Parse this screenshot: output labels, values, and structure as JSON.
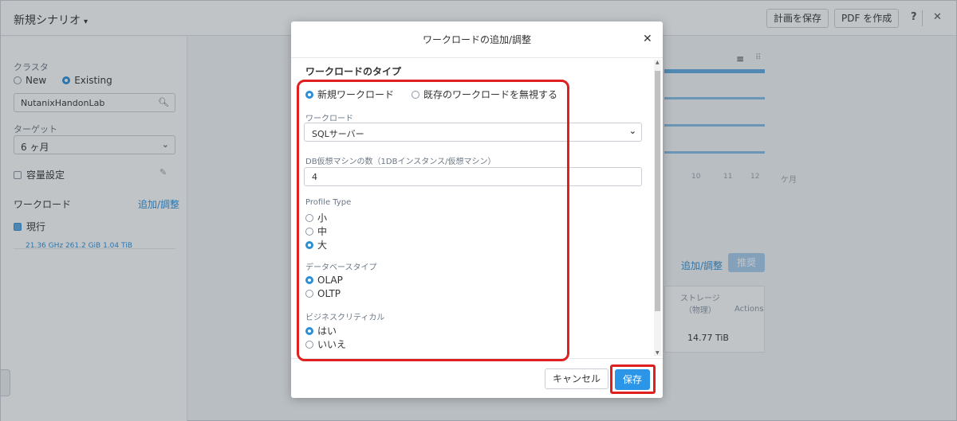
{
  "app": {
    "title": "新規シナリオ",
    "save_plan_label": "計画を保存",
    "create_pdf_label": "PDF を作成",
    "help_icon": "question-icon",
    "close_icon": "close-icon"
  },
  "sidebar": {
    "cluster_label": "クラスタ",
    "cluster_options": [
      "New",
      "Existing"
    ],
    "cluster_selected": "Existing",
    "cluster_search_value": "NutanixHandonLab",
    "target_label": "ターゲット",
    "target_value": "6 ヶ月",
    "capacity_label": "容量設定",
    "workload_label": "ワークロード",
    "add_adjust_link": "追加/調整",
    "current_label": "現行",
    "current_stats": "21.36 GHz   261.2 GiB   1.04 TiB"
  },
  "background": {
    "months": [
      "10",
      "11",
      "12",
      "ケ月"
    ],
    "add_adjust_link": "追加/調整",
    "recommend_button": "推奨",
    "table_header_storage": "ストレージ\n（物理）",
    "table_header_actions": "Actions",
    "table_storage_value": "14.77 TiB"
  },
  "modal": {
    "title": "ワークロードの追加/調整",
    "section_title": "ワークロードのタイプ",
    "type_options": [
      "新規ワークロード",
      "既存のワークロードを無視する"
    ],
    "type_selected": "新規ワークロード",
    "workload_label": "ワークロード",
    "workload_value": "SQLサーバー",
    "vm_count_label": "DB仮想マシンの数（1DBインスタンス/仮想マシン）",
    "vm_count_value": "4",
    "profile_type_label": "Profile Type",
    "profile_options": [
      "小",
      "中",
      "大"
    ],
    "profile_selected": "大",
    "db_type_label": "データベースタイプ",
    "db_type_options": [
      "OLAP",
      "OLTP"
    ],
    "db_type_selected": "OLAP",
    "business_critical_label": "ビジネスクリティカル",
    "business_critical_options": [
      "はい",
      "いいえ"
    ],
    "business_critical_selected": "はい",
    "cancel_label": "キャンセル",
    "save_label": "保存"
  },
  "colors": {
    "accent": "#2b95e8",
    "highlight": "#e02020"
  }
}
